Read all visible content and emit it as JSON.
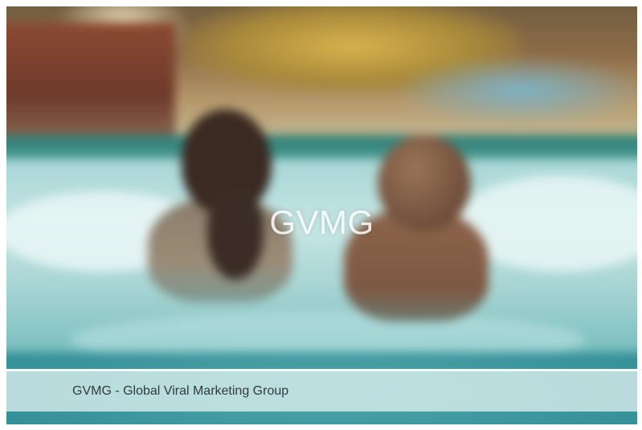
{
  "slide": {
    "overlay_title": "GVMG",
    "caption": "GVMG - Global Viral Marketing Group"
  },
  "colors": {
    "water": "#7fb9b8",
    "caption_bar": "#d6ecec",
    "caption_text": "#2f3b3d",
    "overlay_text": "#ffffff"
  }
}
